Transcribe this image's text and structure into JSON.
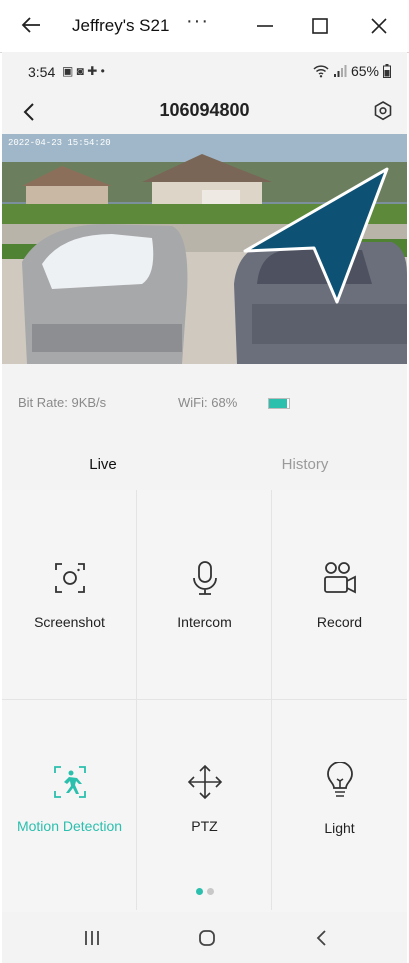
{
  "window": {
    "title": "Jeffrey's S21",
    "more_label": "···"
  },
  "status": {
    "time": "3:54",
    "notif_icons": "▣ ◙ ✚ •",
    "battery": "65%"
  },
  "header": {
    "device_id": "106094800"
  },
  "video": {
    "timestamp": "2022-04-23 15:54:20"
  },
  "stats": {
    "bitrate_label": "Bit Rate:",
    "bitrate_value": "9KB/s",
    "wifi_label": "WiFi:",
    "wifi_value": "68%",
    "battery_level": 0.9
  },
  "tabs": [
    {
      "label": "Live"
    },
    {
      "label": "History"
    }
  ],
  "actions": [
    {
      "label": "Screenshot",
      "icon": "screenshot-icon"
    },
    {
      "label": "Intercom",
      "icon": "microphone-icon"
    },
    {
      "label": "Record",
      "icon": "record-icon"
    },
    {
      "label": "Motion Detection",
      "icon": "motion-detection-icon"
    },
    {
      "label": "PTZ",
      "icon": "ptz-arrows-icon"
    },
    {
      "label": "Light",
      "icon": "lightbulb-icon"
    }
  ],
  "pager": {
    "pages": 2,
    "active": 0
  },
  "colors": {
    "accent": "#2bbfae",
    "pointer": "#0d5275"
  }
}
